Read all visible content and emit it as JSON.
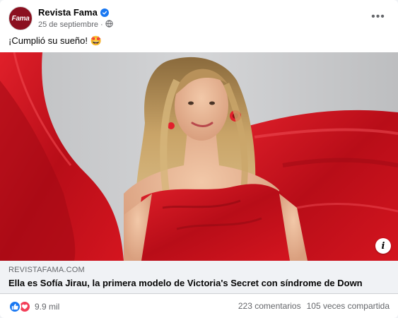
{
  "post": {
    "page_name": "Revista Fama",
    "avatar_text": "Fama",
    "date": "25 de septiembre",
    "separator": "·",
    "privacy_icon": "globe-icon",
    "more_icon": "more-horizontal-icon",
    "caption": "¡Cumplió su sueño! 🤩"
  },
  "link": {
    "domain": "REVISTAFAMA.COM",
    "title": "Ella es Sofía Jirau, la primera modelo de Victoria's Secret con síndrome de Down"
  },
  "stats": {
    "reaction_count": "9.9 mil",
    "comments": "223 comentarios",
    "shares": "105 veces compartida"
  },
  "colors": {
    "brand": "#1877f2",
    "love": "#f33e58",
    "avatar_bg": "#8b1020",
    "dress_red": "#c8101c"
  }
}
